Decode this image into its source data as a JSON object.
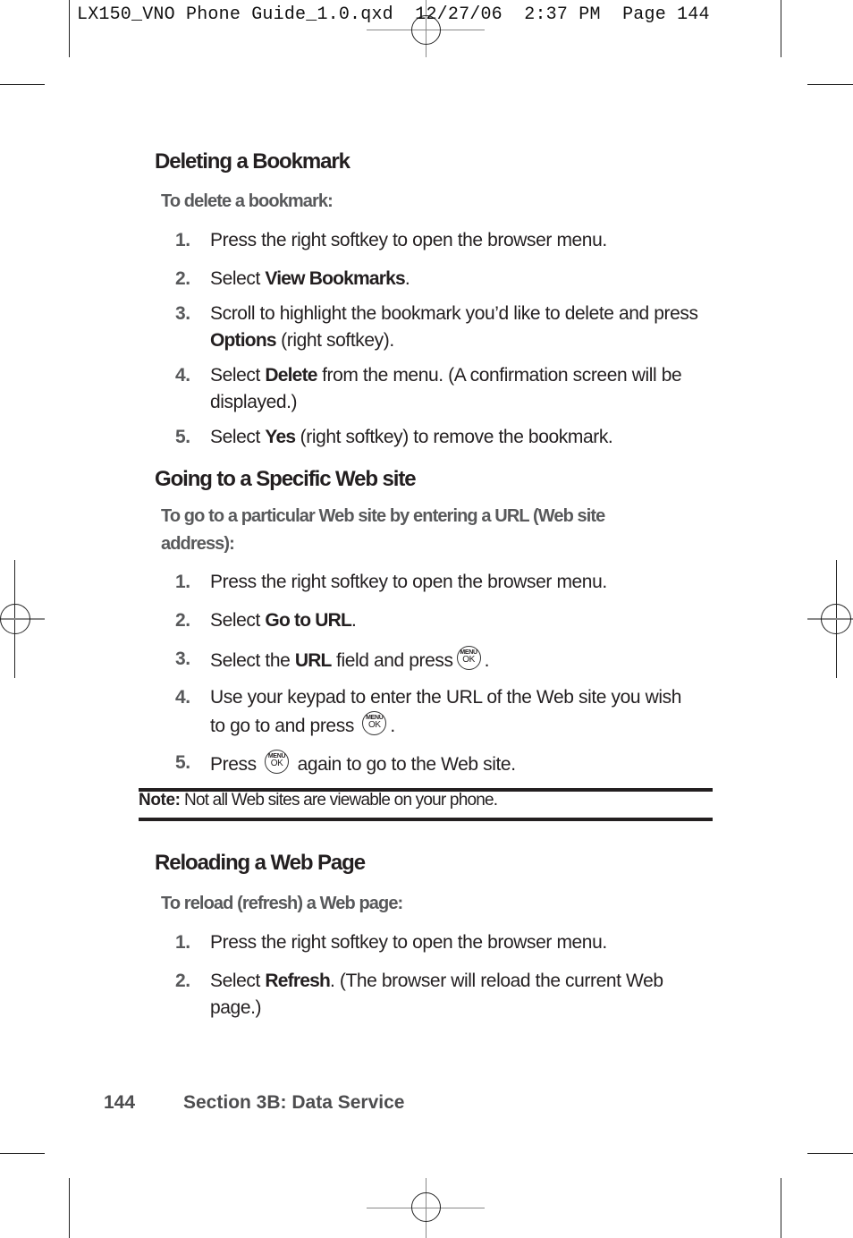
{
  "slug_line": "LX150_VNO Phone Guide_1.0.qxd  12/27/06  2:37 PM  Page 144",
  "sections": [
    {
      "heading": "Deleting a Bookmark",
      "intro": "To delete a bookmark:",
      "steps": [
        {
          "num": "1.",
          "parts": [
            "Press the right softkey to open the browser menu."
          ]
        },
        {
          "num": "2.",
          "pre": "Select ",
          "bold": "View Bookmarks",
          "post": "."
        },
        {
          "num": "3.",
          "pre": "Scroll to highlight the bookmark you’d like to delete and press ",
          "bold": "Options",
          "post": " (right softkey)."
        },
        {
          "num": "4.",
          "pre": "Select ",
          "bold": "Delete",
          "post": " from the menu. (A confirmation screen will be displayed.)"
        },
        {
          "num": "5.",
          "pre": "Select ",
          "bold": "Yes",
          "post": " (right softkey) to remove the bookmark."
        }
      ]
    },
    {
      "heading": "Going to a Specific Web site",
      "intro": "To go to a particular Web site by entering a URL (Web site address):",
      "steps": [
        {
          "num": "1.",
          "pre": "Press the right softkey to open the browser menu."
        },
        {
          "num": "2.",
          "pre": "Select ",
          "bold": "Go to URL",
          "post": "."
        },
        {
          "num": "3.",
          "pre": "Select the ",
          "bold": "URL",
          "post": " field and press",
          "end": "."
        },
        {
          "num": "4.",
          "pre": "Use your keypad to enter the URL of the Web site you wish to go to and press",
          "end": "."
        },
        {
          "num": "5.",
          "pre": "Press",
          "post": "again to go to the Web site."
        }
      ]
    },
    {
      "heading": "Reloading a Web Page",
      "intro": "To reload (refresh) a Web page:",
      "steps": [
        {
          "num": "1.",
          "pre": "Press the right softkey to open the browser menu."
        },
        {
          "num": "2.",
          "pre": "Select ",
          "bold": "Refresh",
          "post": ". (The browser will reload the current Web page.)"
        }
      ]
    }
  ],
  "key_icon": {
    "name": "menu-ok-key",
    "top": "MENU",
    "bottom": "OK"
  },
  "note": {
    "label": "Note:",
    "text": " Not all Web sites are viewable on your phone."
  },
  "footer": {
    "page_number": "144",
    "section": "Section 3B: Data Service"
  }
}
